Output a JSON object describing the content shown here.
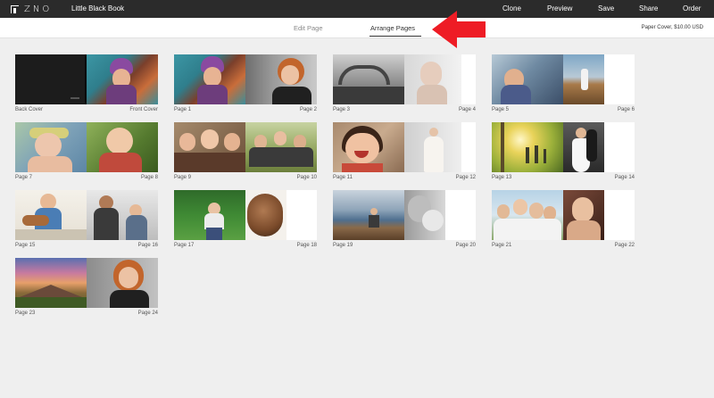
{
  "header": {
    "logo_text": "ZNO",
    "book_title": "Little Black Book",
    "menu": [
      "Clone",
      "Preview",
      "Save",
      "Share",
      "Order"
    ]
  },
  "tabs": {
    "edit": "Edit Page",
    "arrange": "Arrange Pages",
    "active": "arrange",
    "price": "Paper Cover, $10.00 USD"
  },
  "colors": {
    "topbar": "#2b2b2b",
    "background": "#efefef",
    "arrow": "#ee1c25"
  },
  "spreads": [
    {
      "left_label": "Back Cover",
      "right_label": "Front Cover"
    },
    {
      "left_label": "Page 1",
      "right_label": "Page 2"
    },
    {
      "left_label": "Page 3",
      "right_label": "Page 4"
    },
    {
      "left_label": "Page 5",
      "right_label": "Page 6"
    },
    {
      "left_label": "Page 7",
      "right_label": "Page 8"
    },
    {
      "left_label": "Page 9",
      "right_label": "Page 10"
    },
    {
      "left_label": "Page 11",
      "right_label": "Page 12"
    },
    {
      "left_label": "Page 13",
      "right_label": "Page 14"
    },
    {
      "left_label": "Page 15",
      "right_label": "Page 16"
    },
    {
      "left_label": "Page 17",
      "right_label": "Page 18"
    },
    {
      "left_label": "Page 19",
      "right_label": "Page 20"
    },
    {
      "left_label": "Page 21",
      "right_label": "Page 22"
    },
    {
      "left_label": "Page 23",
      "right_label": "Page 24"
    }
  ]
}
